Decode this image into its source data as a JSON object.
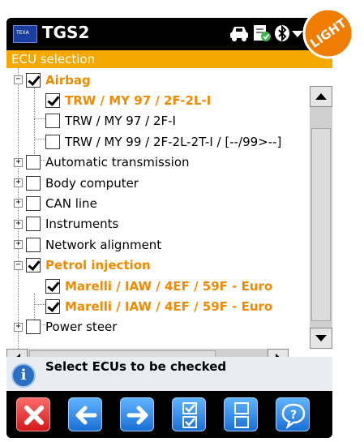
{
  "title_bar": {
    "logo_text": "TEXA",
    "title": "TGS2",
    "icons": [
      "car-icon",
      "document-check-icon",
      "bluetooth-icon",
      "dropdown-icon"
    ]
  },
  "badge": {
    "text": "LIGHT",
    "color": "#f07d00"
  },
  "section_header": {
    "text": "ECU selection",
    "color": "#f5a800"
  },
  "tree": {
    "items": [
      {
        "label": "Airbag",
        "level": 0,
        "expander": "−",
        "checked": true,
        "highlight": true
      },
      {
        "label": "TRW / MY 97 / 2F-2L-I",
        "level": 1,
        "checked": true,
        "highlight": true
      },
      {
        "label": "TRW / MY 97 / 2F-I",
        "level": 1,
        "checked": false,
        "highlight": false
      },
      {
        "label": "TRW / MY 99 / 2F-2L-2T-I / [--/99>--]",
        "level": 1,
        "checked": false,
        "highlight": false
      },
      {
        "label": "Automatic transmission",
        "level": 0,
        "expander": "+",
        "checked": false,
        "highlight": false
      },
      {
        "label": "Body computer",
        "level": 0,
        "expander": "+",
        "checked": false,
        "highlight": false
      },
      {
        "label": "CAN line",
        "level": 0,
        "expander": "+",
        "checked": false,
        "highlight": false
      },
      {
        "label": "Instruments",
        "level": 0,
        "expander": "+",
        "checked": false,
        "highlight": false
      },
      {
        "label": "Network alignment",
        "level": 0,
        "expander": "+",
        "checked": false,
        "highlight": false
      },
      {
        "label": "Petrol injection",
        "level": 0,
        "expander": "−",
        "checked": true,
        "highlight": true
      },
      {
        "label": "Marelli / IAW / 4EF / 59F - Euro",
        "level": 1,
        "checked": true,
        "highlight": true
      },
      {
        "label": "Marelli / IAW / 4EF / 59F - Euro",
        "level": 1,
        "checked": true,
        "highlight": true
      },
      {
        "label": "Power steer",
        "level": 0,
        "expander": "+",
        "checked": false,
        "highlight": false
      }
    ]
  },
  "info": {
    "icon": "info-icon",
    "text": "Select ECUs to be checked"
  },
  "toolbar": {
    "buttons": [
      {
        "name": "cancel-button",
        "icon": "close-icon",
        "color": "#e02020"
      },
      {
        "name": "back-button",
        "icon": "arrow-left-icon",
        "color": "#2c8ce8"
      },
      {
        "name": "forward-button",
        "icon": "arrow-right-icon",
        "color": "#2c8ce8"
      },
      {
        "name": "select-all-button",
        "icon": "check-all-icon",
        "color": "#2c8ce8"
      },
      {
        "name": "deselect-all-button",
        "icon": "uncheck-all-icon",
        "color": "#2c8ce8"
      },
      {
        "name": "help-button",
        "icon": "help-icon",
        "color": "#2c8ce8"
      }
    ]
  }
}
